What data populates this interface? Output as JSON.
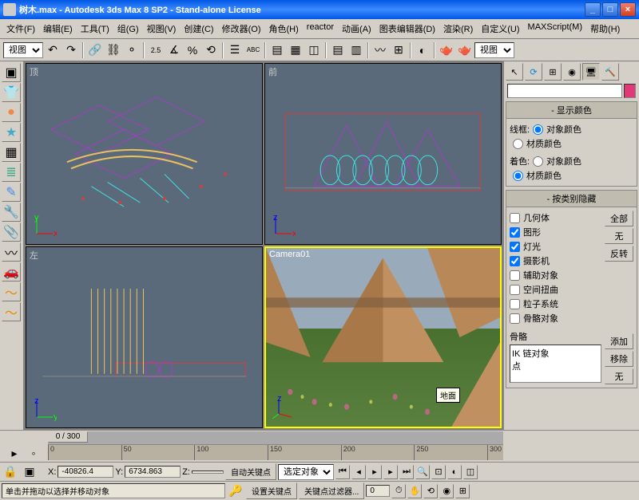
{
  "title": "树木.max - Autodesk 3ds Max 8 SP2  - Stand-alone License",
  "menu": [
    "文件(F)",
    "编辑(E)",
    "工具(T)",
    "组(G)",
    "视图(V)",
    "创建(C)",
    "修改器(O)",
    "角色(H)",
    "reactor",
    "动画(A)",
    "图表编辑器(D)",
    "渲染(R)",
    "自定义(U)",
    "MAXScript(M)",
    "帮助(H)"
  ],
  "toolbar": {
    "dropdown1": "视图",
    "dropdown2": "视图",
    "angle_snap": "2.5"
  },
  "viewports": {
    "top": "顶",
    "front": "前",
    "left": "左",
    "camera": "Camera01",
    "camera_tooltip": "地面"
  },
  "panel": {
    "rollout_colors": "显示颜色",
    "wireframe_label": "线框:",
    "shaded_label": "着色:",
    "opt_object": "对象颜色",
    "opt_material": "材质颜色",
    "rollout_hide": "按类别隐藏",
    "cat_geometry": "几何体",
    "cat_shapes": "图形",
    "cat_lights": "灯光",
    "cat_cameras": "摄影机",
    "cat_helpers": "辅助对象",
    "cat_space": "空间扭曲",
    "cat_particle": "粒子系统",
    "cat_bone": "骨骼对象",
    "btn_all": "全部",
    "btn_none": "无",
    "btn_invert": "反转",
    "bone_label": "骨骼",
    "bone_ik": "IK 链对象",
    "bone_point": "点",
    "btn_add": "添加",
    "btn_remove": "移除",
    "btn_none2": "无"
  },
  "timeline": {
    "slider": "0 / 300",
    "ticks": [
      "0",
      "50",
      "100",
      "150",
      "200",
      "250",
      "300"
    ]
  },
  "status": {
    "x_label": "X:",
    "x": "-40826.4",
    "y_label": "Y:",
    "y": "6734.863",
    "z_label": "Z:",
    "z": "",
    "autokey": "自动关键点",
    "selected": "选定对象",
    "setkey": "设置关键点",
    "keyfilter": "关键点过滤器...",
    "prompt": "单击并拖动以选择并移动对象"
  }
}
